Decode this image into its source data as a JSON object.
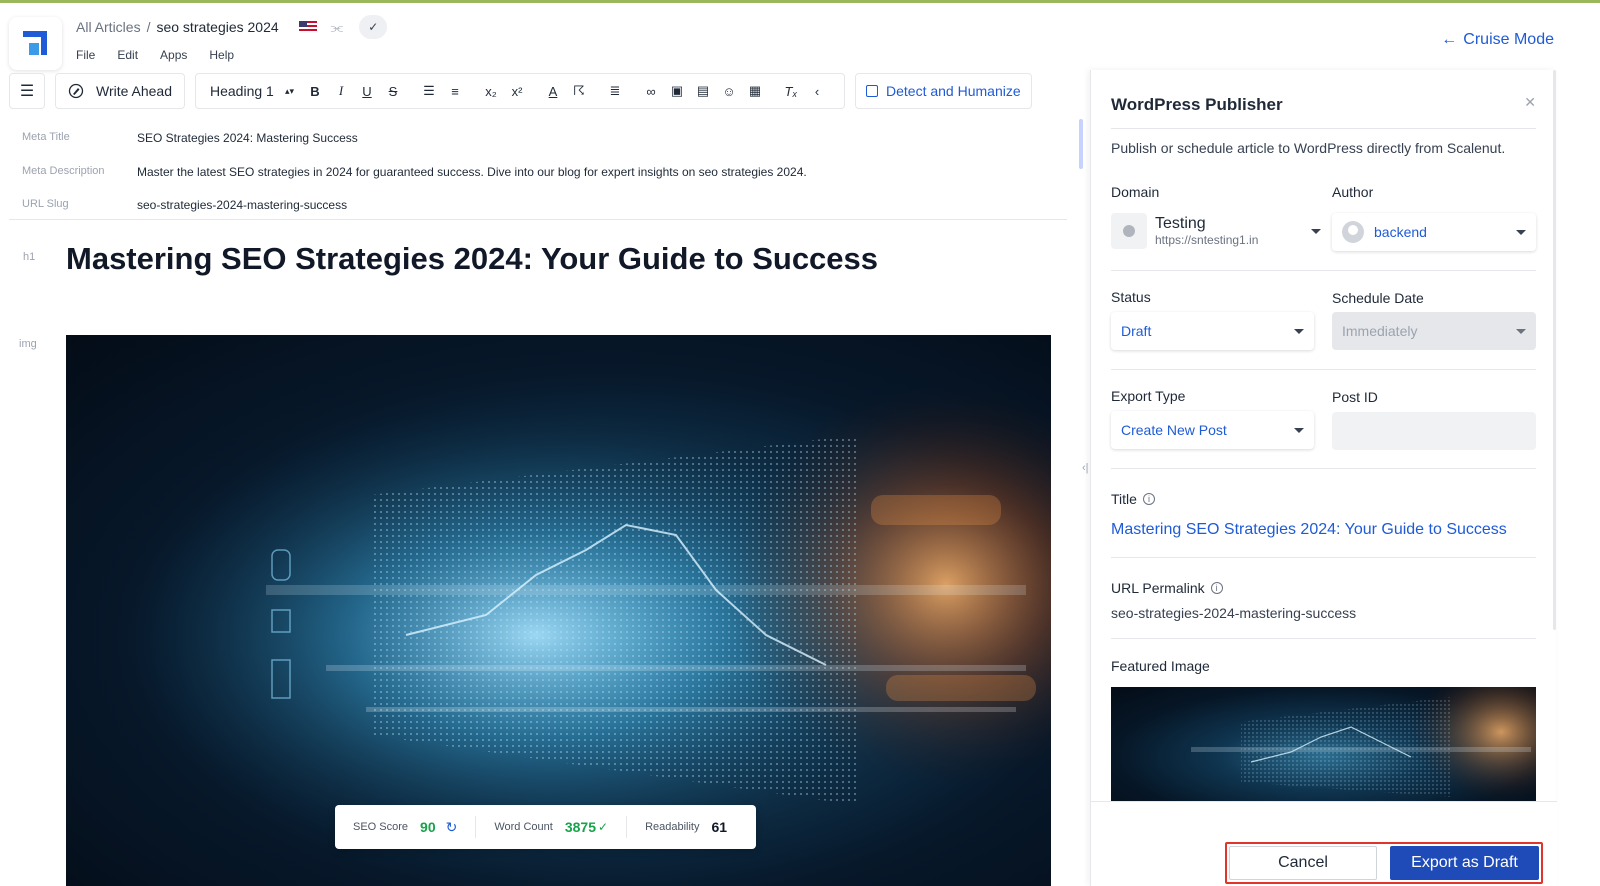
{
  "header": {
    "breadcrumb_root": "All Articles",
    "breadcrumb_sep": "/",
    "breadcrumb_current": "seo strategies 2024",
    "menu": [
      "File",
      "Edit",
      "Apps",
      "Help"
    ],
    "cruise_mode": "Cruise Mode"
  },
  "toolbar": {
    "write_ahead": "Write Ahead",
    "heading_select": "Heading 1",
    "bold": "B",
    "italic": "I",
    "underline": "U",
    "strike": "S",
    "subscript": "x₂",
    "superscript": "x²",
    "detect_humanize": "Detect and Humanize"
  },
  "editor": {
    "meta_title_label": "Meta Title",
    "meta_title": "SEO Strategies 2024: Mastering Success",
    "meta_description_label": "Meta Description",
    "meta_description": "Master the latest SEO strategies in 2024 for guaranteed success. Dive into our blog for expert insights on seo strategies 2024.",
    "url_slug_label": "URL Slug",
    "url_slug": "seo-strategies-2024-mastering-success",
    "h1_label": "h1",
    "h1": "Mastering SEO Strategies 2024: Your Guide to Success",
    "img_label": "img"
  },
  "stats": {
    "seo_score_label": "SEO Score",
    "seo_score": "90",
    "word_count_label": "Word Count",
    "word_count": "3875",
    "readability_label": "Readability",
    "readability": "61"
  },
  "panel": {
    "title": "WordPress Publisher",
    "description": "Publish or schedule article to WordPress directly from Scalenut.",
    "domain_label": "Domain",
    "domain_name": "Testing",
    "domain_url": "https://sntesting1.in",
    "author_label": "Author",
    "author": "backend",
    "status_label": "Status",
    "status": "Draft",
    "schedule_label": "Schedule Date",
    "schedule": "Immediately",
    "export_type_label": "Export Type",
    "export_type": "Create New Post",
    "post_id_label": "Post ID",
    "post_id": "",
    "title_label": "Title",
    "title_value": "Mastering SEO Strategies 2024: Your Guide to Success",
    "permalink_label": "URL Permalink",
    "permalink": "seo-strategies-2024-mastering-success",
    "featured_label": "Featured Image",
    "cancel": "Cancel",
    "export": "Export as Draft"
  },
  "colors": {
    "accent": "#1f5bd6",
    "primary_button": "#1f4bb8",
    "highlight_box": "#e0342d",
    "score_green": "#16a34a"
  }
}
